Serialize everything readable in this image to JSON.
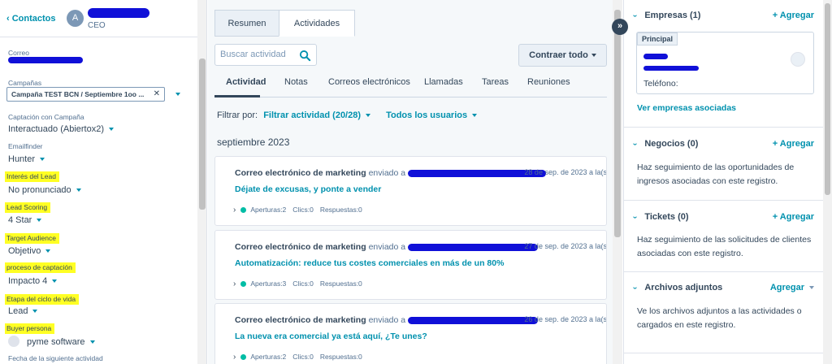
{
  "header": {
    "back_label": "Contactos",
    "avatar_letter": "A",
    "role": "CEO"
  },
  "fields": [
    {
      "label": "Correo",
      "value": "",
      "highlighted": false
    },
    {
      "label": "Campañas",
      "value": "Campaña TEST BCN / Septiembre 1oo ...",
      "highlighted": false
    },
    {
      "label": "Captación con Campaña",
      "value": "Interactuado (Abiertox2)",
      "highlighted": false
    },
    {
      "label": "Emailfinder",
      "value": "Hunter",
      "highlighted": false
    },
    {
      "label": "Interés del Lead",
      "value": "No pronunciado",
      "highlighted": true
    },
    {
      "label": "Lead Scoring",
      "value": "4 Star",
      "highlighted": true
    },
    {
      "label": "Target Audience",
      "value": "Objetivo",
      "highlighted": true
    },
    {
      "label": "proceso de captación",
      "value": "Impacto 4",
      "highlighted": true
    },
    {
      "label": "Etapa del ciclo de vida",
      "value": "Lead",
      "highlighted": true
    },
    {
      "label": "Buyer persona",
      "value": "pyme software",
      "highlighted": true
    },
    {
      "label": "Fecha de la siguiente actividad",
      "value": "",
      "highlighted": false
    }
  ],
  "campaign_remove": "✕",
  "main": {
    "top_tabs": [
      {
        "label": "Resumen",
        "active": false
      },
      {
        "label": "Actividades",
        "active": true
      }
    ],
    "search_placeholder": "Buscar actividad",
    "collapse_label": "Contraer todo",
    "sub_tabs": [
      {
        "label": "Actividad",
        "active": true
      },
      {
        "label": "Notas",
        "active": false
      },
      {
        "label": "Correos electrónicos",
        "active": false
      },
      {
        "label": "Llamadas",
        "active": false
      },
      {
        "label": "Tareas",
        "active": false
      },
      {
        "label": "Reuniones",
        "active": false
      }
    ],
    "filter_prefix": "Filtrar por:",
    "filter_activity": "Filtrar actividad (20/28)",
    "filter_users": "Todos los usuarios",
    "month": "septiembre 2023",
    "cards": [
      {
        "title": "Correo electrónico de marketing",
        "sent": "enviado a",
        "date": "28 de sep. de 2023 a la(s)",
        "subject": "Déjate de excusas, y ponte a vender",
        "opens": "Aperturas:2",
        "clicks": "Clics:0",
        "replies": "Respuestas:0"
      },
      {
        "title": "Correo electrónico de marketing",
        "sent": "enviado a",
        "date": "27 de sep. de 2023 a la(s)",
        "subject": "Automatización: reduce tus costes comerciales en más de un 80%",
        "opens": "Aperturas:3",
        "clicks": "Clics:0",
        "replies": "Respuestas:0"
      },
      {
        "title": "Correo electrónico de marketing",
        "sent": "enviado a",
        "date": "26 de sep. de 2023 a la(s)",
        "subject": "La nueva era comercial ya está aquí, ¿Te unes?",
        "opens": "Aperturas:2",
        "clicks": "Clics:0",
        "replies": "Respuestas:0"
      }
    ]
  },
  "right": {
    "companies": {
      "title": "Empresas (1)",
      "add": "+ Agregar",
      "badge": "Principal",
      "phone_label": "Teléfono:",
      "see_link": "Ver empresas asociadas"
    },
    "deals": {
      "title": "Negocios (0)",
      "add": "+ Agregar",
      "text": "Haz seguimiento de las oportunidades de ingresos asociadas con este registro."
    },
    "tickets": {
      "title": "Tickets (0)",
      "add": "+ Agregar",
      "text": "Haz seguimiento de las solicitudes de clientes asociadas con este registro."
    },
    "attachments": {
      "title": "Archivos adjuntos",
      "add": "Agregar",
      "text": "Ve los archivos adjuntos a las actividades o cargados en este registro."
    }
  },
  "colors": {
    "accent": "#0091ae",
    "highlight": "#ffff24",
    "text": "#33475b",
    "redaction": "#1010d8"
  }
}
